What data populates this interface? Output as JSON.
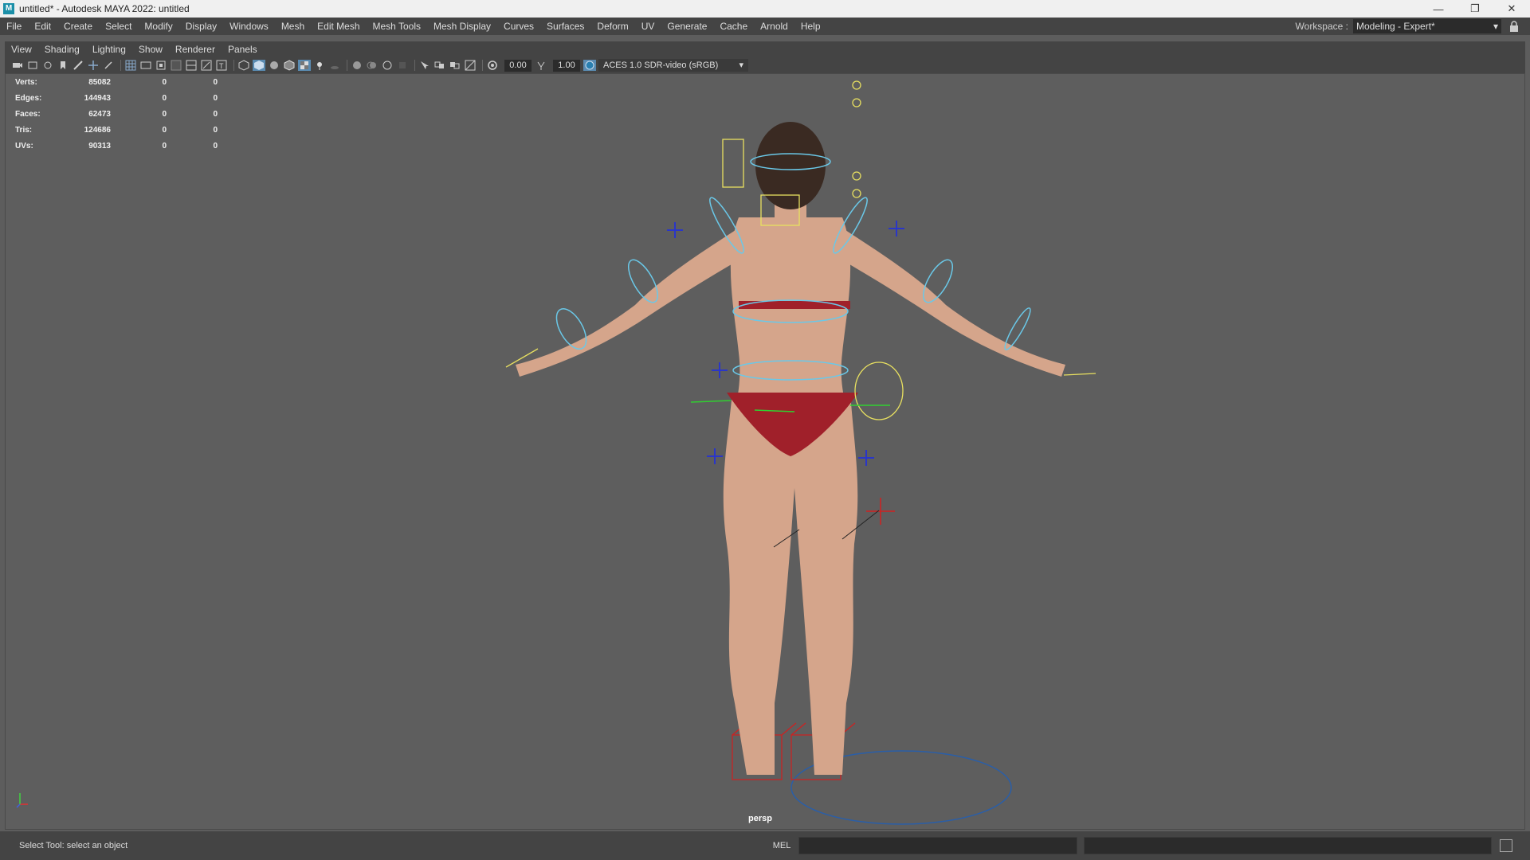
{
  "window": {
    "title": "untitled* - Autodesk MAYA 2022: untitled",
    "app_icon_text": "M",
    "minimize_icon": "minimize-icon",
    "maximize_icon": "restore-icon",
    "close_icon": "close-icon"
  },
  "menubar": {
    "items": [
      "File",
      "Edit",
      "Create",
      "Select",
      "Modify",
      "Display",
      "Windows",
      "Mesh",
      "Edit Mesh",
      "Mesh Tools",
      "Mesh Display",
      "Curves",
      "Surfaces",
      "Deform",
      "UV",
      "Generate",
      "Cache",
      "Arnold",
      "Help"
    ],
    "workspace_label": "Workspace :",
    "workspace_value": "Modeling - Expert*"
  },
  "panel_menu": {
    "items": [
      "View",
      "Shading",
      "Lighting",
      "Show",
      "Renderer",
      "Panels"
    ]
  },
  "toolbar": {
    "exposure": "0.00",
    "gamma": "1.00",
    "color_space": "ACES 1.0 SDR-video (sRGB)"
  },
  "hud": {
    "rows": [
      {
        "label": "Verts:",
        "v1": "85082",
        "v2": "0",
        "v3": "0"
      },
      {
        "label": "Edges:",
        "v1": "144943",
        "v2": "0",
        "v3": "0"
      },
      {
        "label": "Faces:",
        "v1": "62473",
        "v2": "0",
        "v3": "0"
      },
      {
        "label": "Tris:",
        "v1": "124686",
        "v2": "0",
        "v3": "0"
      },
      {
        "label": "UVs:",
        "v1": "90313",
        "v2": "0",
        "v3": "0"
      }
    ]
  },
  "viewport": {
    "camera_label": "persp",
    "background_color": "#5e5e5e"
  },
  "status": {
    "help_line": "Select Tool: select an object",
    "mel_label": "MEL"
  }
}
